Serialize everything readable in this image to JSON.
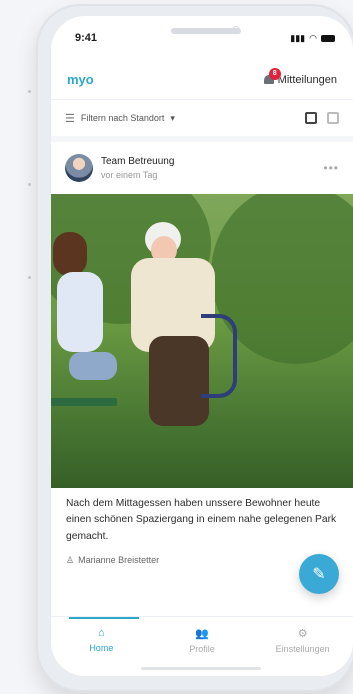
{
  "status": {
    "time": "9:41"
  },
  "appbar": {
    "brand": "myo",
    "notifications_label": "Mitteilungen",
    "badge_count": "8"
  },
  "filter": {
    "label": "Filtern nach Standort"
  },
  "post": {
    "author": "Team Betreuung",
    "timestamp": "vor einem Tag",
    "text": "Nach dem Mittagessen haben unssere Bewohner heute einen schönen Spaziergang in einem nahe gelegenen Park gemacht.",
    "byline": "Marianne Breistetter"
  },
  "tabs": [
    {
      "label": "Home",
      "icon": "home-icon",
      "active": true
    },
    {
      "label": "Profile",
      "icon": "people-icon",
      "active": false
    },
    {
      "label": "Einstellungen",
      "icon": "gear-icon",
      "active": false
    }
  ],
  "colors": {
    "accent": "#2da8c9",
    "badge": "#e0223b",
    "fab": "#3aa9d5"
  }
}
